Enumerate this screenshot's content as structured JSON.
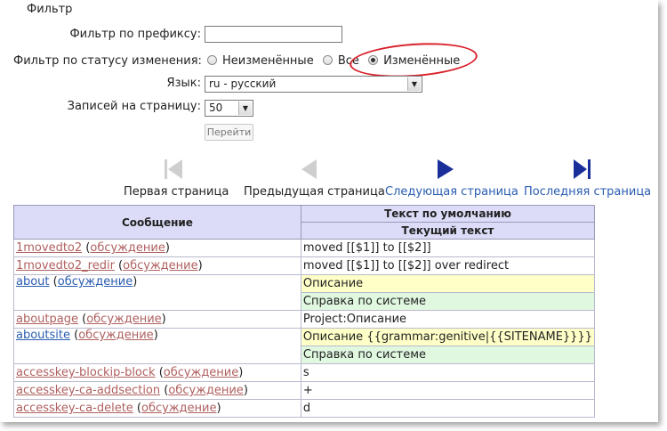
{
  "filter": {
    "legend": "Фильтр",
    "prefix_label": "Фильтр по префиксу:",
    "prefix_value": "",
    "status_label": "Фильтр по статусу изменения:",
    "status_options": [
      "Неизменённые",
      "Все",
      "Изменённые"
    ],
    "status_selected": "Изменённые",
    "language_label": "Язык:",
    "language_value": "ru - русский",
    "per_page_label": "Записей на страницу:",
    "per_page_value": "50",
    "go_label": "Перейти"
  },
  "pagination": {
    "first": "Первая страница",
    "prev": "Предыдущая страница",
    "next": "Следующая страница",
    "last": "Последняя страница"
  },
  "table": {
    "header_message": "Сообщение",
    "header_default": "Текст по умолчанию",
    "header_current": "Текущий текст",
    "talk_label": "обсуждение",
    "rows": [
      {
        "key": "1movedto2",
        "default": "moved [[$1]] to [[$2]]"
      },
      {
        "key": "1movedto2_redir",
        "default": "moved [[$1]] to [[$2]] over redirect"
      },
      {
        "key": "about",
        "default": "Описание",
        "current": "Справка по системе"
      },
      {
        "key": "aboutpage",
        "default": "Project:Описание"
      },
      {
        "key": "aboutsite",
        "default": "Описание {{grammar:genitive|{{SITENAME}}}}",
        "current": "Справка по системе"
      },
      {
        "key": "accesskey-blockip-block",
        "default": "s"
      },
      {
        "key": "accesskey-ca-addsection",
        "default": "+"
      },
      {
        "key": "accesskey-ca-delete",
        "default": "d"
      }
    ]
  }
}
